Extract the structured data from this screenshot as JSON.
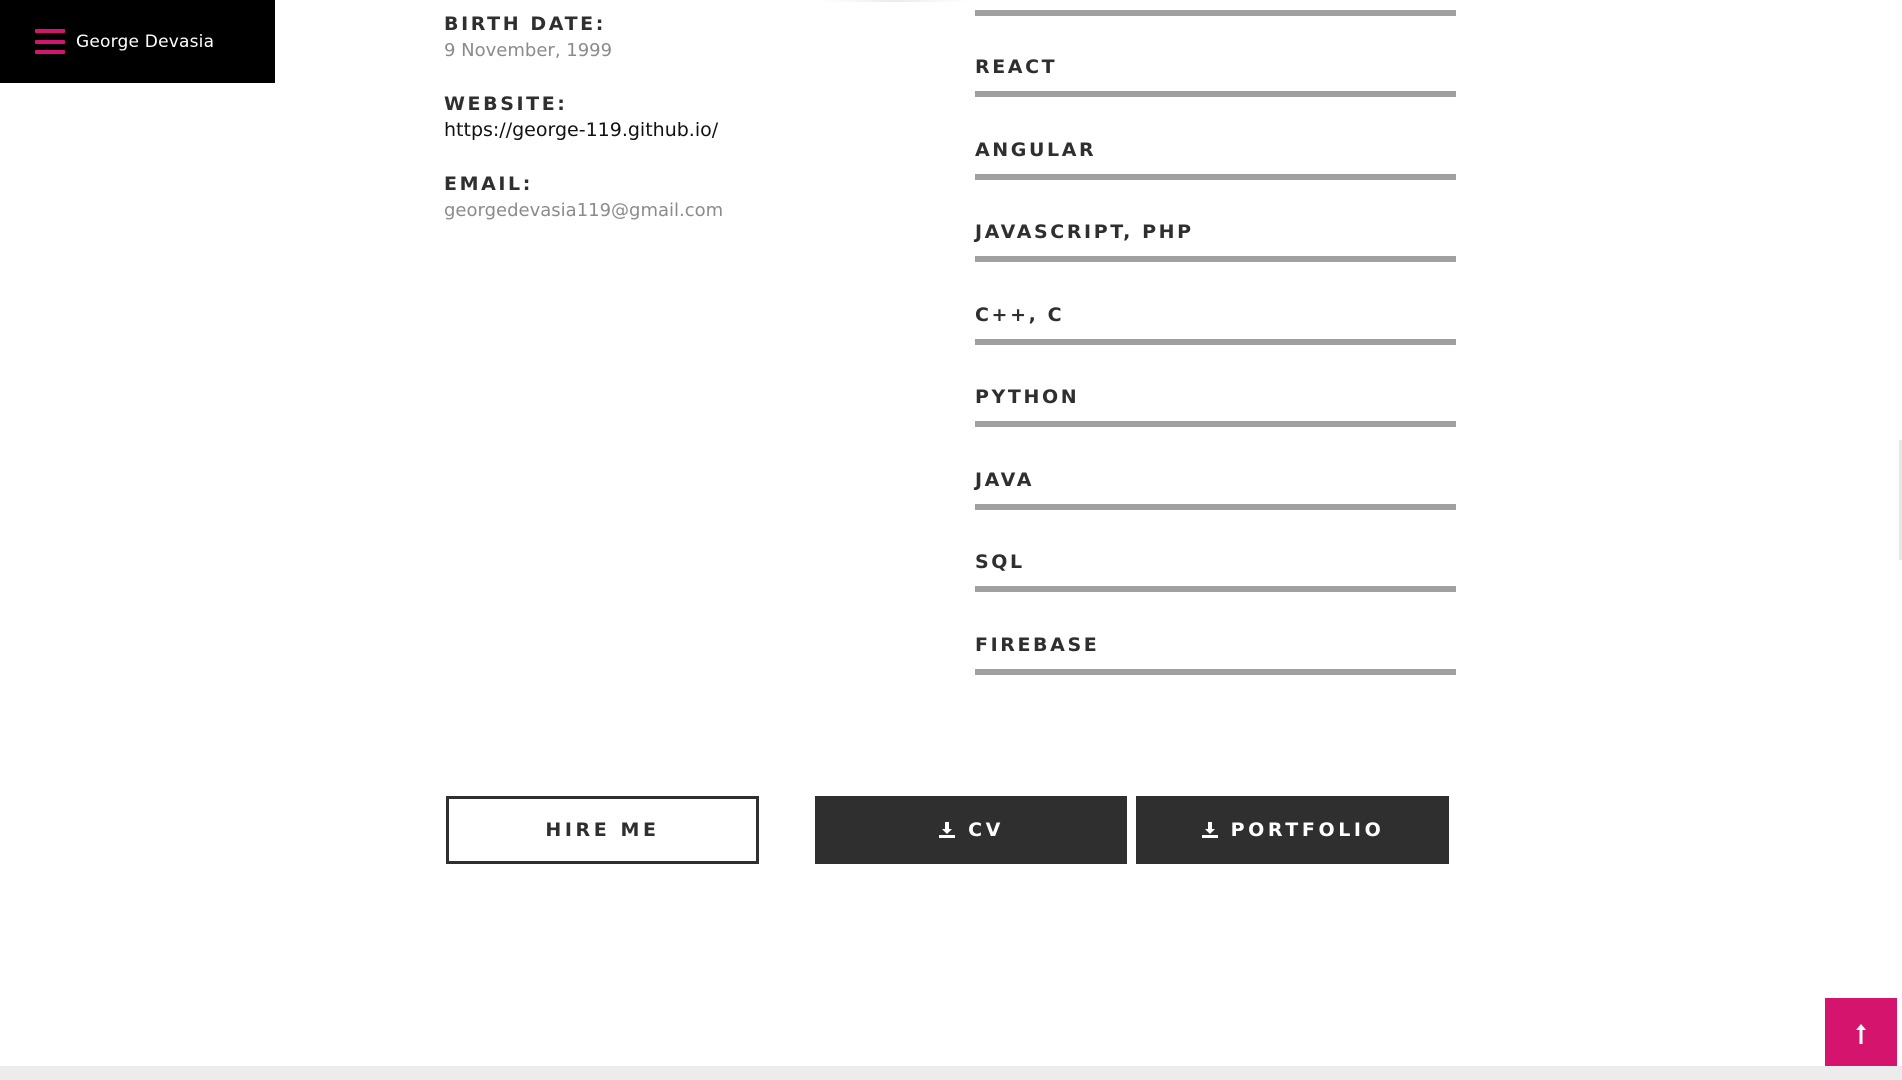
{
  "brand": {
    "name": "George Devasia",
    "menu_icon": "hamburger-menu-icon",
    "accent_color": "#d4146d"
  },
  "info": [
    {
      "label": "BIRTH DATE:",
      "value": "9 November, 1999"
    },
    {
      "label": "WEBSITE:",
      "value": "https://george-119.github.io/"
    },
    {
      "label": "EMAIL:",
      "value": "georgedevasia119@gmail.com"
    }
  ],
  "skills": [
    {
      "name": "REACT",
      "level": 1.0
    },
    {
      "name": "ANGULAR",
      "level": 1.0
    },
    {
      "name": "JAVASCRIPT, PHP",
      "level": 1.0
    },
    {
      "name": "C++, C",
      "level": 1.0
    },
    {
      "name": "PYTHON",
      "level": 1.0
    },
    {
      "name": "JAVA",
      "level": 1.0
    },
    {
      "name": "SQL",
      "level": 1.0
    },
    {
      "name": "FIREBASE",
      "level": 1.0
    }
  ],
  "buttons": {
    "hire": "HIRE ME",
    "cv": "CV",
    "portfolio": "PORTFOLIO",
    "download_icon": "download-icon"
  },
  "back_to_top": {
    "icon": "arrow-up-icon",
    "color": "#d4146d"
  }
}
